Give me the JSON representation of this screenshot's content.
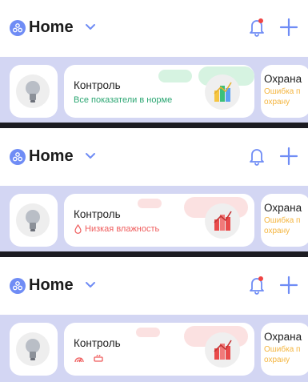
{
  "frames": [
    {
      "header": {
        "title": "Home"
      },
      "cards": {
        "main": {
          "title": "Контроль",
          "status": "Все показатели в норме",
          "status_color": "#2ba672"
        },
        "next": {
          "title": "Охрана",
          "sub_line1": "Ошибка п",
          "sub_line2": "охрану",
          "sub_color": "#f4b53f"
        }
      },
      "chart_icon_colors": [
        "#f5c542",
        "#3cc07a",
        "#5aa0f2"
      ]
    },
    {
      "header": {
        "title": "Home"
      },
      "cards": {
        "main": {
          "title": "Контроль",
          "status": "Низкая влажность",
          "status_color": "#ef5c5c"
        },
        "next": {
          "title": "Охрана",
          "sub_line1": "Ошибка п",
          "sub_line2": "охрану",
          "sub_color": "#f4b53f"
        }
      },
      "chart_icon_colors": [
        "#e84b4b"
      ]
    },
    {
      "header": {
        "title": "Home"
      },
      "cards": {
        "main": {
          "title": "Контроль",
          "status_icons": [
            "humidity-icon",
            "heater-icon"
          ],
          "status_color": "#ef5c5c"
        },
        "next": {
          "title": "Охрана",
          "sub_line1": "Ошибка п",
          "sub_line2": "охрану",
          "sub_color": "#f4b53f"
        }
      },
      "chart_icon_colors": [
        "#e84b4b"
      ]
    }
  ],
  "colors": {
    "accent": "#6f8cf5",
    "strip": "#d3d6f3",
    "bell_badge": "#ef4444"
  },
  "icons": {
    "logo": "home-logo-icon",
    "chevron": "chevron-down-icon",
    "bell": "bell-icon",
    "add": "plus-icon",
    "bulb": "light-bulb-icon",
    "chart": "chart-icon"
  }
}
